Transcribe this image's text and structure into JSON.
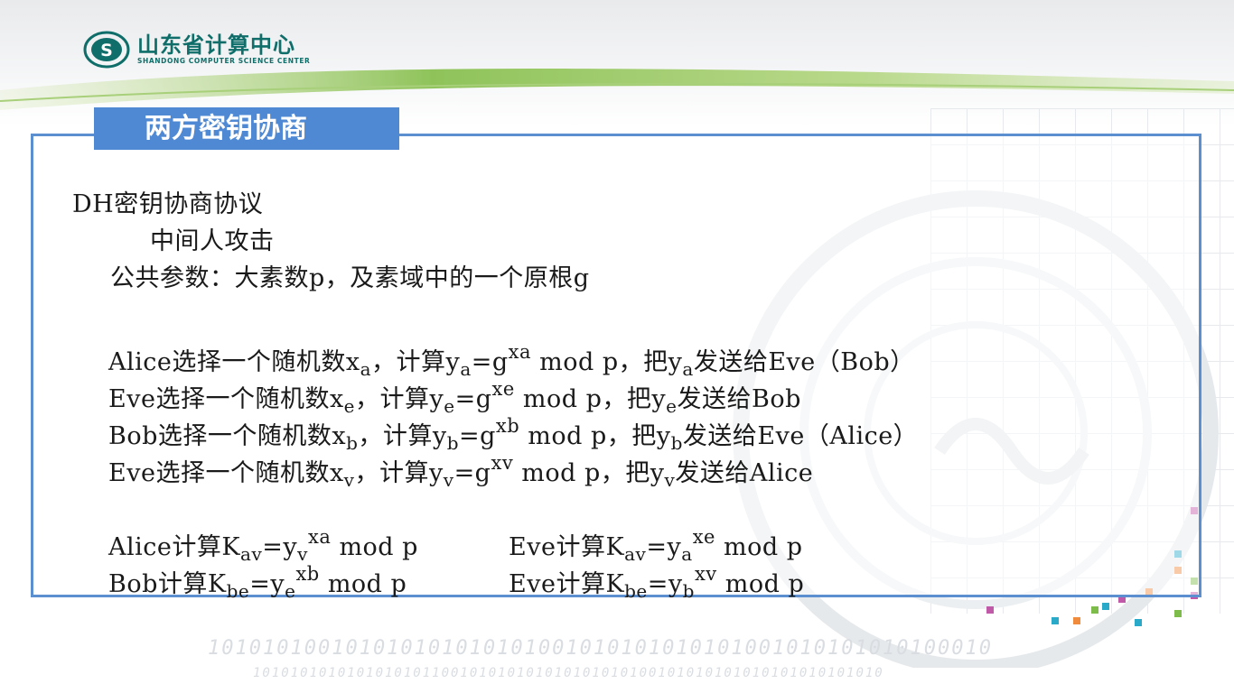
{
  "logo": {
    "name_cn": "山东省计算中心",
    "name_en": "SHANDONG COMPUTER SCIENCE CENTER",
    "emblem_letter": "S"
  },
  "slide": {
    "title": "两方密钥协商",
    "heading": "DH密钥协商协议",
    "subheading": "中间人攻击",
    "params": "公共参数：大素数p，及素域中的一个原根g"
  },
  "binary_decor": {
    "row1": "101010100101010101010101001010101010101001010101010100010",
    "row2": "1010101010101010101100101010101010101010100101010101010101010101010"
  },
  "steps": [
    [
      {
        "t": "Alice选择一个随机数x"
      },
      {
        "t": "a",
        "s": "sub"
      },
      {
        "t": "，计算y"
      },
      {
        "t": "a",
        "s": "sub"
      },
      {
        "t": "=g"
      },
      {
        "t": "xa",
        "s": "sup"
      },
      {
        "t": " mod p，把y"
      },
      {
        "t": "a",
        "s": "sub"
      },
      {
        "t": "发送给Eve（Bob）"
      }
    ],
    [
      {
        "t": "Eve选择一个随机数x"
      },
      {
        "t": "e",
        "s": "sub"
      },
      {
        "t": "，计算y"
      },
      {
        "t": "e",
        "s": "sub"
      },
      {
        "t": "=g"
      },
      {
        "t": "xe",
        "s": "sup"
      },
      {
        "t": " mod p，把y"
      },
      {
        "t": "e",
        "s": "sub"
      },
      {
        "t": "发送给Bob"
      }
    ],
    [
      {
        "t": "Bob选择一个随机数x"
      },
      {
        "t": "b",
        "s": "sub"
      },
      {
        "t": "，计算y"
      },
      {
        "t": "b",
        "s": "sub"
      },
      {
        "t": "=g"
      },
      {
        "t": "xb",
        "s": "sup"
      },
      {
        "t": " mod p，把y"
      },
      {
        "t": "b",
        "s": "sub"
      },
      {
        "t": "发送给Eve（Alice）"
      }
    ],
    [
      {
        "t": "Eve选择一个随机数x"
      },
      {
        "t": "v",
        "s": "sub"
      },
      {
        "t": "，计算y"
      },
      {
        "t": "v",
        "s": "sub"
      },
      {
        "t": "=g"
      },
      {
        "t": "xv",
        "s": "sup"
      },
      {
        "t": " mod p，把y"
      },
      {
        "t": "v",
        "s": "sub"
      },
      {
        "t": "发送给Alice"
      }
    ]
  ],
  "keys": [
    [
      {
        "t": "Alice计算K"
      },
      {
        "t": "av",
        "s": "sub"
      },
      {
        "t": "=y"
      },
      {
        "t": "v",
        "s": "sub"
      },
      {
        "t": "xa",
        "s": "sup"
      },
      {
        "t": " mod p"
      }
    ],
    [
      {
        "t": "Eve计算K"
      },
      {
        "t": "av",
        "s": "sub"
      },
      {
        "t": "=y"
      },
      {
        "t": "a",
        "s": "sub"
      },
      {
        "t": "xe",
        "s": "sup"
      },
      {
        "t": " mod p"
      }
    ],
    [
      {
        "t": "Bob计算K"
      },
      {
        "t": "be",
        "s": "sub"
      },
      {
        "t": "=y"
      },
      {
        "t": "e",
        "s": "sub"
      },
      {
        "t": "xb",
        "s": "sup"
      },
      {
        "t": " mod p"
      }
    ],
    [
      {
        "t": "Eve计算K"
      },
      {
        "t": "be",
        "s": "sub"
      },
      {
        "t": "=y"
      },
      {
        "t": "b",
        "s": "sub"
      },
      {
        "t": "xv",
        "s": "sup"
      },
      {
        "t": " mod p"
      }
    ]
  ],
  "colors": {
    "frame": "#5b8fd0",
    "title_tab": "#4f88d3",
    "logo_green": "#0f6e6a",
    "text": "#1a1a1a"
  }
}
